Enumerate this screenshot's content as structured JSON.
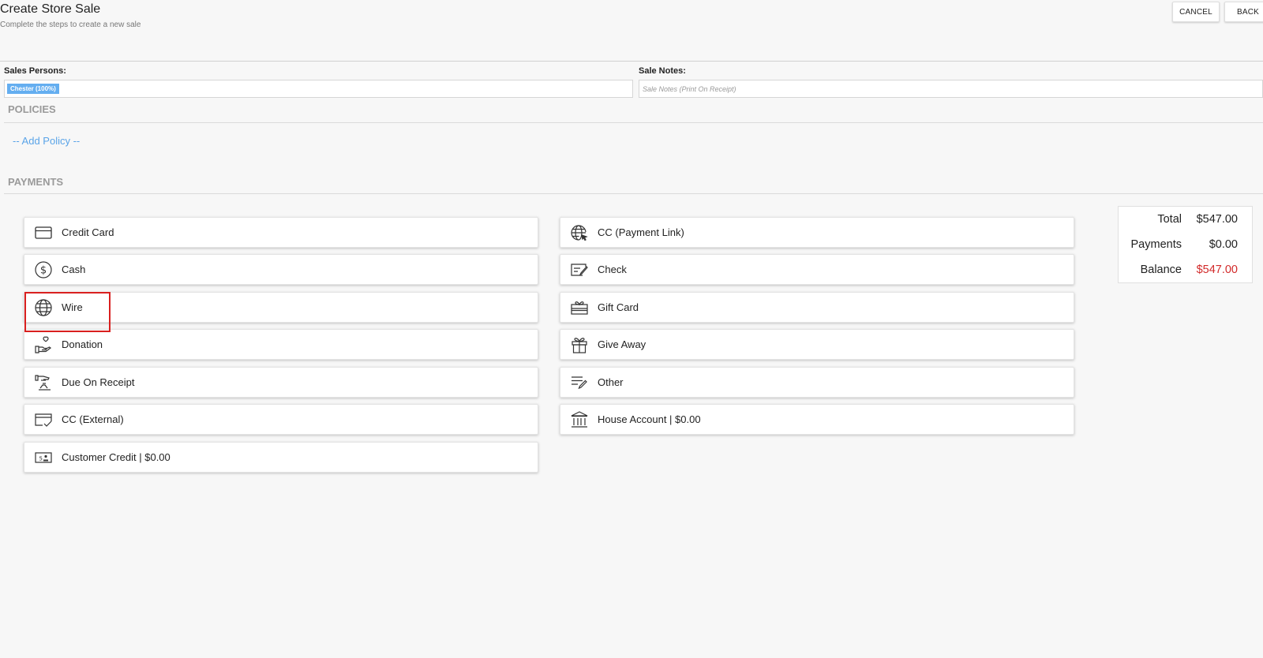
{
  "header": {
    "title": "Create Store Sale",
    "subtitle": "Complete the steps to create a new sale",
    "cancel_label": "CANCEL",
    "back_label": "BACK"
  },
  "sales_persons": {
    "label": "Sales Persons:",
    "chip": "Chester (100%)"
  },
  "sale_notes": {
    "label": "Sale Notes:",
    "placeholder": "Sale Notes (Print On Receipt)",
    "value": ""
  },
  "policies": {
    "title": "POLICIES",
    "add_label": "-- Add Policy --"
  },
  "payments": {
    "title": "PAYMENTS",
    "left": [
      {
        "label": "Credit Card",
        "icon": "credit-card-icon"
      },
      {
        "label": "Cash",
        "icon": "dollar-coin-icon"
      },
      {
        "label": "Wire",
        "icon": "globe-icon"
      },
      {
        "label": "Donation",
        "icon": "hand-heart-icon"
      },
      {
        "label": "Due On Receipt",
        "icon": "hand-receipt-icon"
      },
      {
        "label": "CC (External)",
        "icon": "card-check-icon"
      },
      {
        "label": "Customer Credit | $0.00",
        "icon": "id-card-icon"
      }
    ],
    "right": [
      {
        "label": "CC (Payment Link)",
        "icon": "globe-cursor-icon"
      },
      {
        "label": "Check",
        "icon": "check-pen-icon"
      },
      {
        "label": "Gift Card",
        "icon": "gift-card-icon"
      },
      {
        "label": "Give Away",
        "icon": "gift-box-icon"
      },
      {
        "label": "Other",
        "icon": "list-pen-icon"
      },
      {
        "label": "House Account | $0.00",
        "icon": "bank-icon"
      }
    ],
    "highlight_color": "#d9201f"
  },
  "summary": {
    "total_label": "Total",
    "total_value": "$547.00",
    "payments_label": "Payments",
    "payments_value": "$0.00",
    "balance_label": "Balance",
    "balance_value": "$547.00",
    "balance_color": "#d22a2a"
  },
  "colors": {
    "chip": "#64aef0",
    "link": "#5aa4e8",
    "background": "#f7f7f7"
  }
}
